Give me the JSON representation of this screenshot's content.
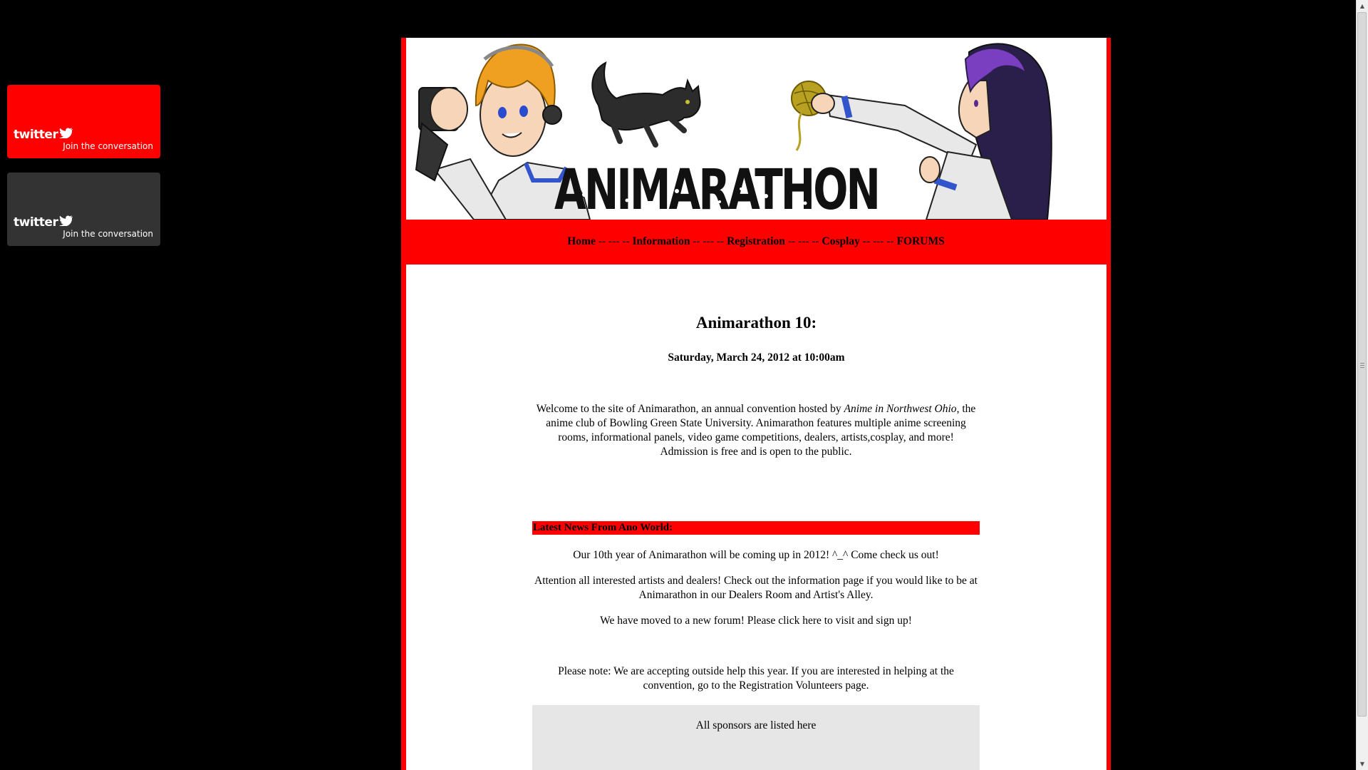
{
  "twitter": {
    "logo_text": "twitter",
    "tagline": "Join the conversation",
    "badges": [
      {
        "color": "#ff0000"
      },
      {
        "color": "#333333"
      }
    ]
  },
  "banner": {
    "logo_text": "ANIMARATHON"
  },
  "nav": {
    "items": [
      "Home",
      "Information",
      "Registration",
      "Cosplay",
      "FORUMS"
    ],
    "separator": " -- --- -- "
  },
  "content": {
    "title": "Animarathon 10:",
    "date": "Saturday, March 24, 2012 at 10:00am",
    "intro_before": "Welcome to the site of Animarathon, an annual convention hosted by ",
    "intro_club": "Anime in Northwest Ohio",
    "intro_after": ", the anime club of Bowling Green State University. Animarathon features multiple anime screening rooms, informational panels, video game competitions, dealers, artists,cosplay, and more! Admission is free and is open to the public.",
    "news_heading": "Latest News From Ano World:",
    "news": [
      "Our 10th year of Animarathon will be coming up in 2012! ^_^ Come check us out!",
      "Attention all interested artists and dealers! Check out the information page if you would like to be at Animarathon in our Dealers Room and Artist's Alley.",
      "We have moved to a new forum! Please click here to visit and sign up!",
      "Please note: We are accepting outside help this year. If you are interested in helping at the convention, go to the Registration Volunteers page."
    ],
    "sponsors_text": "All sponsors are listed here"
  },
  "colors": {
    "accent": "#ff0000",
    "background": "#000000",
    "content_bg": "#ffffff",
    "sponsor_bg": "#e6e6e6"
  }
}
